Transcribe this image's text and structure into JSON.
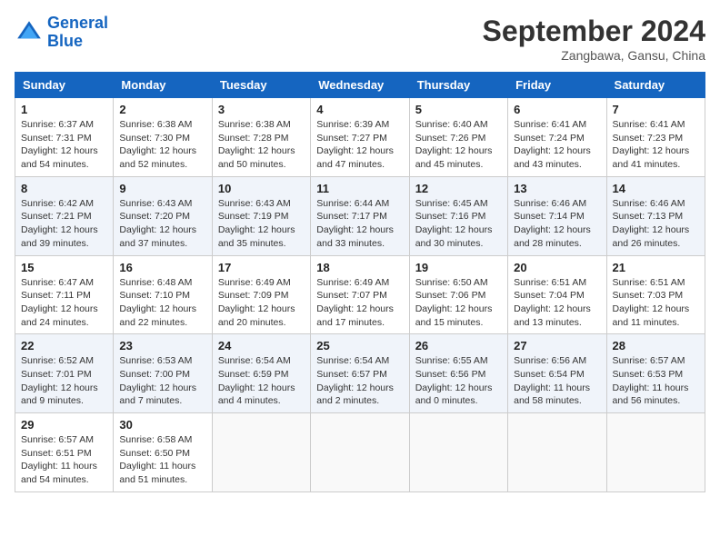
{
  "header": {
    "logo_line1": "General",
    "logo_line2": "Blue",
    "month_title": "September 2024",
    "location": "Zangbawa, Gansu, China"
  },
  "weekdays": [
    "Sunday",
    "Monday",
    "Tuesday",
    "Wednesday",
    "Thursday",
    "Friday",
    "Saturday"
  ],
  "weeks": [
    [
      {
        "day": "1",
        "sunrise": "6:37 AM",
        "sunset": "7:31 PM",
        "daylight": "12 hours and 54 minutes."
      },
      {
        "day": "2",
        "sunrise": "6:38 AM",
        "sunset": "7:30 PM",
        "daylight": "12 hours and 52 minutes."
      },
      {
        "day": "3",
        "sunrise": "6:38 AM",
        "sunset": "7:28 PM",
        "daylight": "12 hours and 50 minutes."
      },
      {
        "day": "4",
        "sunrise": "6:39 AM",
        "sunset": "7:27 PM",
        "daylight": "12 hours and 47 minutes."
      },
      {
        "day": "5",
        "sunrise": "6:40 AM",
        "sunset": "7:26 PM",
        "daylight": "12 hours and 45 minutes."
      },
      {
        "day": "6",
        "sunrise": "6:41 AM",
        "sunset": "7:24 PM",
        "daylight": "12 hours and 43 minutes."
      },
      {
        "day": "7",
        "sunrise": "6:41 AM",
        "sunset": "7:23 PM",
        "daylight": "12 hours and 41 minutes."
      }
    ],
    [
      {
        "day": "8",
        "sunrise": "6:42 AM",
        "sunset": "7:21 PM",
        "daylight": "12 hours and 39 minutes."
      },
      {
        "day": "9",
        "sunrise": "6:43 AM",
        "sunset": "7:20 PM",
        "daylight": "12 hours and 37 minutes."
      },
      {
        "day": "10",
        "sunrise": "6:43 AM",
        "sunset": "7:19 PM",
        "daylight": "12 hours and 35 minutes."
      },
      {
        "day": "11",
        "sunrise": "6:44 AM",
        "sunset": "7:17 PM",
        "daylight": "12 hours and 33 minutes."
      },
      {
        "day": "12",
        "sunrise": "6:45 AM",
        "sunset": "7:16 PM",
        "daylight": "12 hours and 30 minutes."
      },
      {
        "day": "13",
        "sunrise": "6:46 AM",
        "sunset": "7:14 PM",
        "daylight": "12 hours and 28 minutes."
      },
      {
        "day": "14",
        "sunrise": "6:46 AM",
        "sunset": "7:13 PM",
        "daylight": "12 hours and 26 minutes."
      }
    ],
    [
      {
        "day": "15",
        "sunrise": "6:47 AM",
        "sunset": "7:11 PM",
        "daylight": "12 hours and 24 minutes."
      },
      {
        "day": "16",
        "sunrise": "6:48 AM",
        "sunset": "7:10 PM",
        "daylight": "12 hours and 22 minutes."
      },
      {
        "day": "17",
        "sunrise": "6:49 AM",
        "sunset": "7:09 PM",
        "daylight": "12 hours and 20 minutes."
      },
      {
        "day": "18",
        "sunrise": "6:49 AM",
        "sunset": "7:07 PM",
        "daylight": "12 hours and 17 minutes."
      },
      {
        "day": "19",
        "sunrise": "6:50 AM",
        "sunset": "7:06 PM",
        "daylight": "12 hours and 15 minutes."
      },
      {
        "day": "20",
        "sunrise": "6:51 AM",
        "sunset": "7:04 PM",
        "daylight": "12 hours and 13 minutes."
      },
      {
        "day": "21",
        "sunrise": "6:51 AM",
        "sunset": "7:03 PM",
        "daylight": "12 hours and 11 minutes."
      }
    ],
    [
      {
        "day": "22",
        "sunrise": "6:52 AM",
        "sunset": "7:01 PM",
        "daylight": "12 hours and 9 minutes."
      },
      {
        "day": "23",
        "sunrise": "6:53 AM",
        "sunset": "7:00 PM",
        "daylight": "12 hours and 7 minutes."
      },
      {
        "day": "24",
        "sunrise": "6:54 AM",
        "sunset": "6:59 PM",
        "daylight": "12 hours and 4 minutes."
      },
      {
        "day": "25",
        "sunrise": "6:54 AM",
        "sunset": "6:57 PM",
        "daylight": "12 hours and 2 minutes."
      },
      {
        "day": "26",
        "sunrise": "6:55 AM",
        "sunset": "6:56 PM",
        "daylight": "12 hours and 0 minutes."
      },
      {
        "day": "27",
        "sunrise": "6:56 AM",
        "sunset": "6:54 PM",
        "daylight": "11 hours and 58 minutes."
      },
      {
        "day": "28",
        "sunrise": "6:57 AM",
        "sunset": "6:53 PM",
        "daylight": "11 hours and 56 minutes."
      }
    ],
    [
      {
        "day": "29",
        "sunrise": "6:57 AM",
        "sunset": "6:51 PM",
        "daylight": "11 hours and 54 minutes."
      },
      {
        "day": "30",
        "sunrise": "6:58 AM",
        "sunset": "6:50 PM",
        "daylight": "11 hours and 51 minutes."
      },
      null,
      null,
      null,
      null,
      null
    ]
  ]
}
